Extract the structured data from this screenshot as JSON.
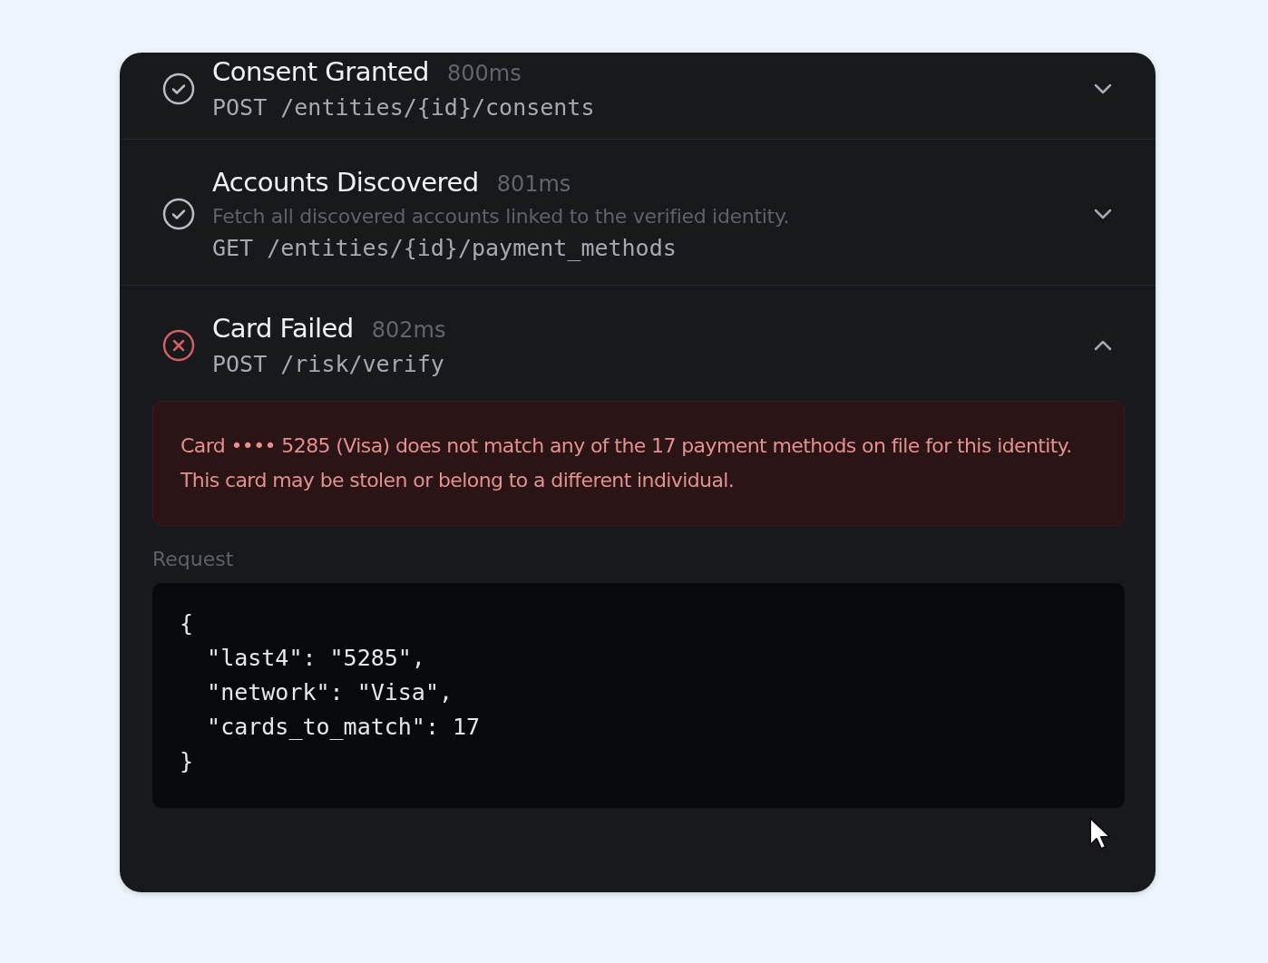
{
  "steps": [
    {
      "title": "Consent Granted",
      "duration": "800ms",
      "endpoint": "POST /entities/{id}/consents",
      "kind": "success",
      "expanded": false
    },
    {
      "title": "Accounts Discovered",
      "duration": "801ms",
      "description": "Fetch all discovered accounts linked to the verified identity.",
      "endpoint": "GET /entities/{id}/payment_methods",
      "kind": "success",
      "expanded": false
    },
    {
      "title": "Card Failed",
      "duration": "802ms",
      "endpoint": "POST /risk/verify",
      "kind": "failed",
      "expanded": true,
      "error": "Card •••• 5285 (Visa) does not match any of the 17 payment methods on file for this identity. This card may be stolen or belong to a different individual.",
      "request_label": "Request",
      "request_code": "{\n  \"last4\": \"5285\",\n  \"network\": \"Visa\",\n  \"cards_to_match\": 17\n}"
    }
  ]
}
